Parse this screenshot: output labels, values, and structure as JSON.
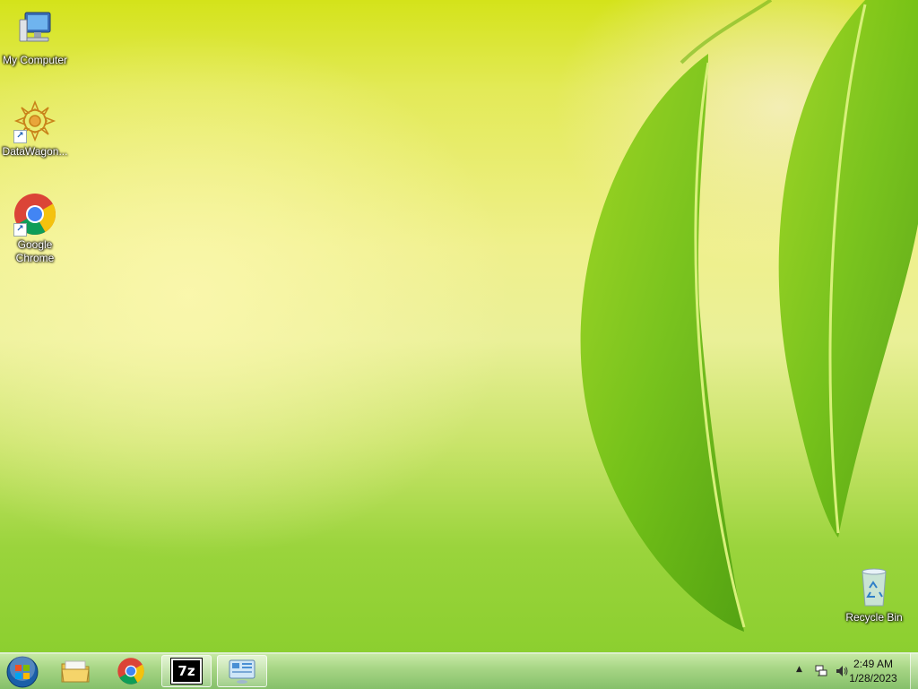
{
  "desktop": {
    "icons": [
      {
        "label": "My Computer",
        "icon": "computer-icon"
      },
      {
        "label": "DataWagon...",
        "icon": "datawagon-icon"
      },
      {
        "label": "Google\nChrome",
        "icon": "chrome-icon"
      },
      {
        "label": "Recycle Bin",
        "icon": "recycle-bin-icon"
      }
    ]
  },
  "taskbar": {
    "buttons": [
      {
        "icon": "start-orb-icon"
      },
      {
        "icon": "file-explorer-icon"
      },
      {
        "icon": "chrome-icon"
      },
      {
        "icon": "7zip-icon",
        "text": "7z"
      },
      {
        "icon": "control-panel-icon"
      }
    ],
    "tray": {
      "icons": [
        "show-hidden-icons-icon",
        "network-icon",
        "volume-icon"
      ]
    },
    "clock": {
      "time": "2:49 AM",
      "date": "1/28/2023"
    }
  },
  "colors": {
    "accent": "#1f6fd1"
  }
}
